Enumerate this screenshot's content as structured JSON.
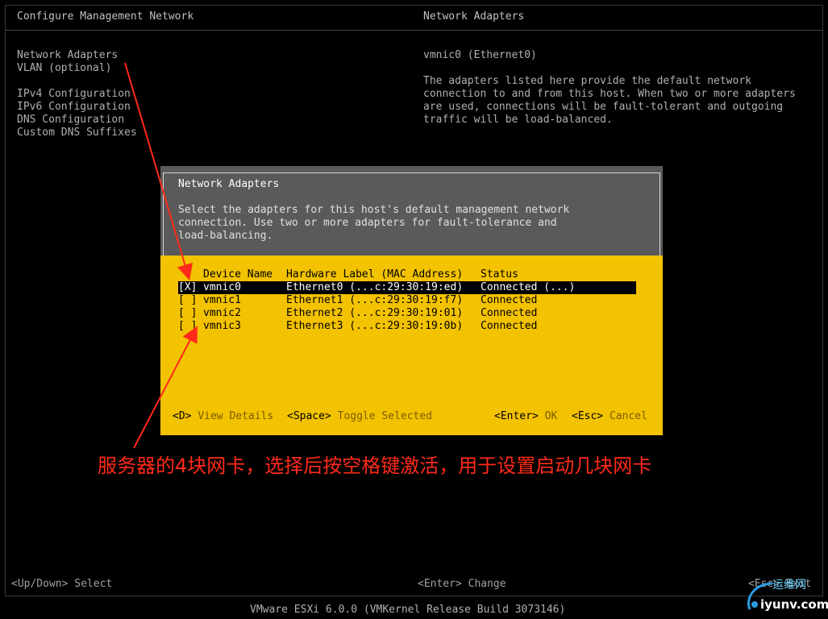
{
  "header": {
    "left_title": "Configure Management Network",
    "right_title": "Network Adapters"
  },
  "menu": {
    "items": [
      "Network Adapters",
      "VLAN (optional)",
      "IPv4 Configuration",
      "IPv6 Configuration",
      "DNS Configuration",
      "Custom DNS Suffixes"
    ]
  },
  "info": {
    "adapter": "vmnic0 (Ethernet0)",
    "description": "The adapters listed here provide the default network\nconnection to and from this host. When two or more adapters\nare used, connections will be fault-tolerant and outgoing\ntraffic will be load-balanced."
  },
  "dialog": {
    "title": "Network Adapters",
    "description": "Select the adapters for this host's default management network\nconnection. Use two or more adapters for fault-tolerance and\nload-balancing.",
    "columns": [
      "Device Name",
      "Hardware Label (MAC Address)",
      "Status"
    ],
    "rows": [
      {
        "check": "[X]",
        "device": "vmnic0",
        "label": "Ethernet0 (...c:29:30:19:ed)",
        "status": "Connected (...)"
      },
      {
        "check": "[ ]",
        "device": "vmnic1",
        "label": "Ethernet1 (...c:29:30:19:f7)",
        "status": "Connected"
      },
      {
        "check": "[ ]",
        "device": "vmnic2",
        "label": "Ethernet2 (...c:29:30:19:01)",
        "status": "Connected"
      },
      {
        "check": "[ ]",
        "device": "vmnic3",
        "label": "Ethernet3 (...c:29:30:19:0b)",
        "status": "Connected"
      }
    ],
    "footer": {
      "d_key": "<D>",
      "d_text": "View Details",
      "space_key": "<Space>",
      "space_text": "Toggle Selected",
      "enter_key": "<Enter>",
      "enter_text": "OK",
      "esc_key": "<Esc>",
      "esc_text": "Cancel"
    }
  },
  "annotation": {
    "text": "服务器的4块网卡，选择后按空格键激活，用于设置启动几块网卡",
    "color": "#ff2a1a"
  },
  "footer": {
    "left": "<Up/Down> Select",
    "middle": "<Enter> Change",
    "right": "<Esc> Exit",
    "version": "VMware ESXi 6.0.0 (VMKernel Release Build 3073146)"
  },
  "watermark": {
    "line1": "运维网",
    "line2": "iyunv.com"
  },
  "colors": {
    "background": "#000000",
    "dialog_yellow": "#f3c200",
    "dialog_header": "#5a5a5a"
  }
}
